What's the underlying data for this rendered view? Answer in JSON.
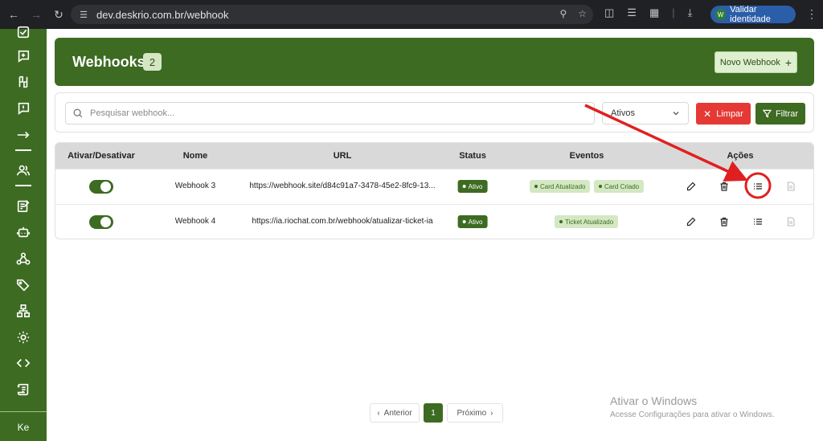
{
  "browser": {
    "url": "dev.deskrio.com.br/webhook",
    "identity_button": "Validar identidade",
    "identity_initial": "W"
  },
  "sidebar": {
    "user_initials": "Ke"
  },
  "header": {
    "title": "Webhooks",
    "count": "2",
    "new_button": "Novo Webhook"
  },
  "filters": {
    "search_placeholder": "Pesquisar webhook...",
    "status_selected": "Ativos",
    "clear_button": "Limpar",
    "filter_button": "Filtrar"
  },
  "table": {
    "headers": {
      "toggle": "Ativar/Desativar",
      "name": "Nome",
      "url": "URL",
      "status": "Status",
      "events": "Eventos",
      "actions": "Ações"
    },
    "rows": [
      {
        "active": true,
        "name": "Webhook 3",
        "url": "https://webhook.site/d84c91a7-3478-45e2-8fc9-13...",
        "status": "Ativo",
        "events": [
          "Card Atualizado",
          "Card Criado"
        ]
      },
      {
        "active": true,
        "name": "Webhook 4",
        "url": "https://ia.riochat.com.br/webhook/atualizar-ticket-ia",
        "status": "Ativo",
        "events": [
          "Ticket Atualizado"
        ]
      }
    ]
  },
  "pagination": {
    "prev": "Anterior",
    "current": "1",
    "next": "Próximo"
  },
  "watermark": {
    "title": "Ativar o Windows",
    "subtitle": "Acesse Configurações para ativar o Windows."
  },
  "colors": {
    "primary": "#3d6b22",
    "danger": "#e53935",
    "annotation": "#e02020"
  }
}
